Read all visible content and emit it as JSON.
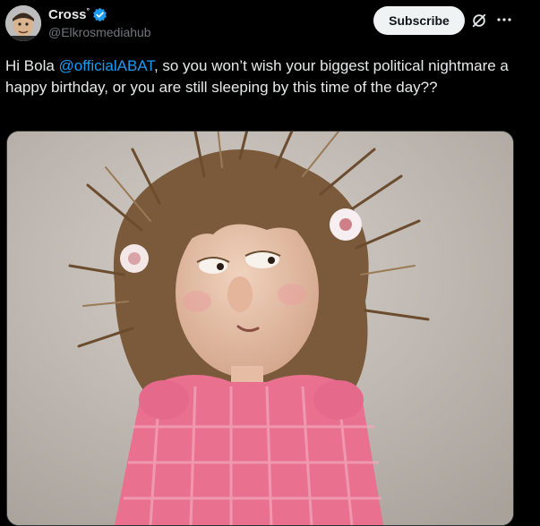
{
  "author": {
    "name": "Cross",
    "name_suffix": "°",
    "handle": "@Elkrosmediahub",
    "verified": true
  },
  "actions": {
    "subscribe_label": "Subscribe",
    "grok_icon": "grok-icon",
    "more_icon": "more-icon"
  },
  "tweet": {
    "text_before": "Hi Bola ",
    "mention": "@officialABAT",
    "text_after": ", so you won’t wish your biggest political nightmare a happy birthday, or you are still sleeping by this time of the day??"
  },
  "colors": {
    "background": "#000000",
    "text": "#e7e9ea",
    "secondary": "#71767b",
    "accent": "#1d9bf0",
    "button_bg": "#eff3f4"
  }
}
